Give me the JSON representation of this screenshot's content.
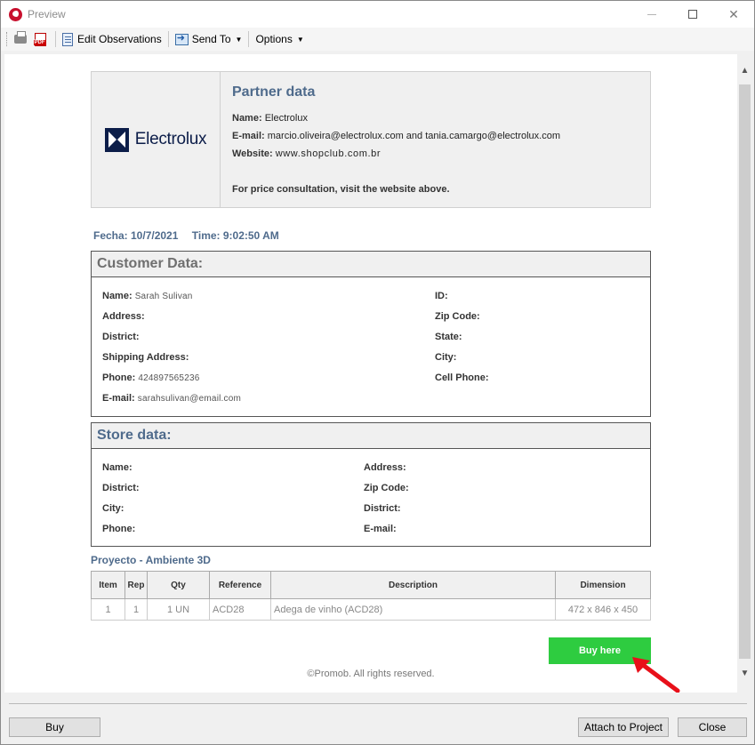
{
  "window": {
    "title": "Preview"
  },
  "toolbar": {
    "edit_observations": "Edit Observations",
    "send_to": "Send To",
    "options": "Options"
  },
  "partner": {
    "logo_text": "Electrolux",
    "title": "Partner data",
    "name_label": "Name:",
    "name_value": "Electrolux",
    "email_label": "E-mail:",
    "email_value": "marcio.oliveira@electrolux.com and tania.camargo@electrolux.com",
    "website_label": "Website:",
    "website_value": "www.shopclub.com.br",
    "note": "For price consultation, visit the website above."
  },
  "datetime": {
    "date": "Fecha: 10/7/2021",
    "time": "Time: 9:02:50 AM"
  },
  "customer": {
    "title": "Customer Data:",
    "name_label": "Name:",
    "name_value": "Sarah Sulivan",
    "address_label": "Address:",
    "district_label": "District:",
    "shipping_label": "Shipping Address:",
    "phone_label": "Phone:",
    "phone_value": "424897565236",
    "email_label": "E-mail:",
    "email_value": "sarahsulivan@email.com",
    "id_label": "ID:",
    "zip_label": "Zip Code:",
    "state_label": "State:",
    "city_label": "City:",
    "cell_label": "Cell Phone:"
  },
  "store": {
    "title": "Store data:",
    "name_label": "Name:",
    "district_label": "District:",
    "city_label": "City:",
    "phone_label": "Phone:",
    "address_label": "Address:",
    "zip_label": "Zip Code:",
    "district2_label": "District:",
    "email_label": "E-mail:"
  },
  "project": {
    "title": "Proyecto - Ambiente 3D",
    "headers": [
      "Item",
      "Rep",
      "Qty",
      "Reference",
      "Description",
      "Dimension"
    ],
    "rows": [
      [
        "1",
        "1",
        "1 UN",
        "ACD28",
        "Adega de vinho (ACD28)",
        "472 x 846 x 450"
      ]
    ]
  },
  "buy_here": "Buy here",
  "copyright": "©Promob. All rights reserved.",
  "footer": {
    "buy": "Buy",
    "attach": "Attach to Project",
    "close": "Close"
  },
  "colors": {
    "accent_green": "#2ecc40",
    "heading_blue": "#4f6b8c",
    "arrow_red": "#e8101a"
  }
}
